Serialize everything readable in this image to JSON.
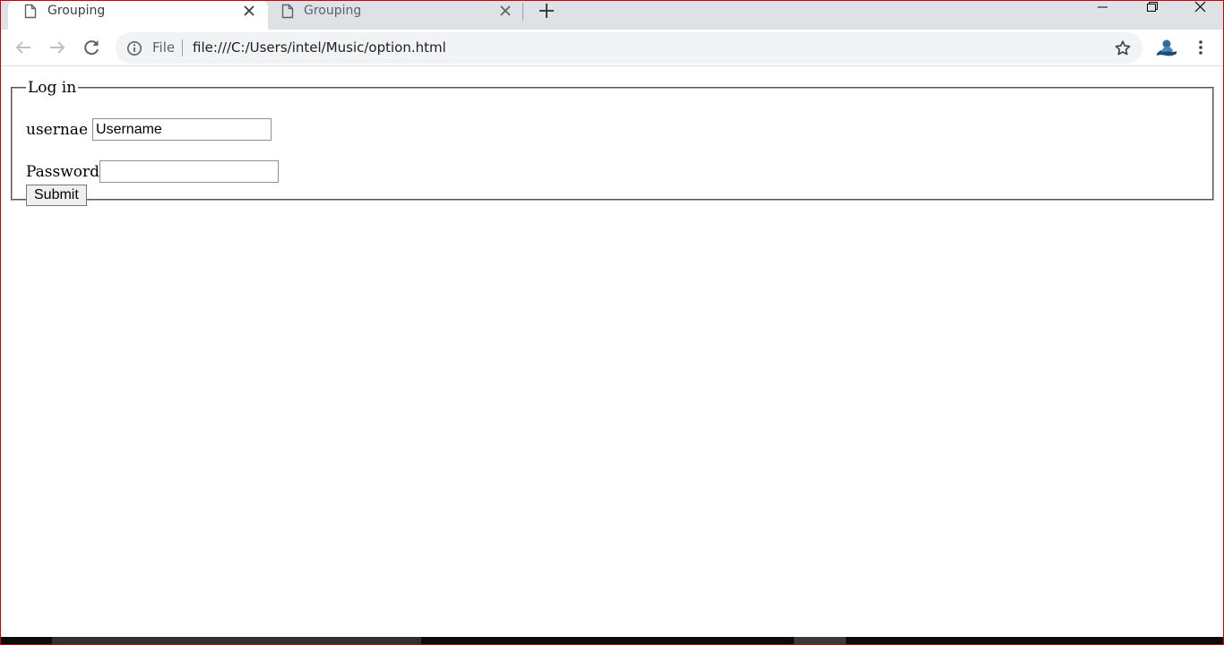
{
  "tabs": [
    {
      "title": "Grouping",
      "active": true
    },
    {
      "title": "Grouping",
      "active": false
    }
  ],
  "toolbar": {
    "scheme_label": "File",
    "url": "file:///C:/Users/intel/Music/option.html"
  },
  "form": {
    "legend": "Log in",
    "username_label": "usernae",
    "username_placeholder": "Username",
    "password_label": "Password",
    "password_value": "",
    "submit_label": "Submit"
  },
  "icons": {
    "tab_icon": "page-icon",
    "close": "close-icon",
    "new_tab": "plus-icon",
    "back": "back-arrow-icon",
    "forward": "forward-arrow-icon",
    "reload": "reload-icon",
    "info": "info-icon",
    "bookmark": "star-icon",
    "profile": "profile-avatar-icon",
    "menu": "kebab-menu-icon"
  },
  "colors": {
    "tabstrip": "#dee1e6",
    "omnibox": "#f1f3f4",
    "frame_border": "#d20000"
  }
}
